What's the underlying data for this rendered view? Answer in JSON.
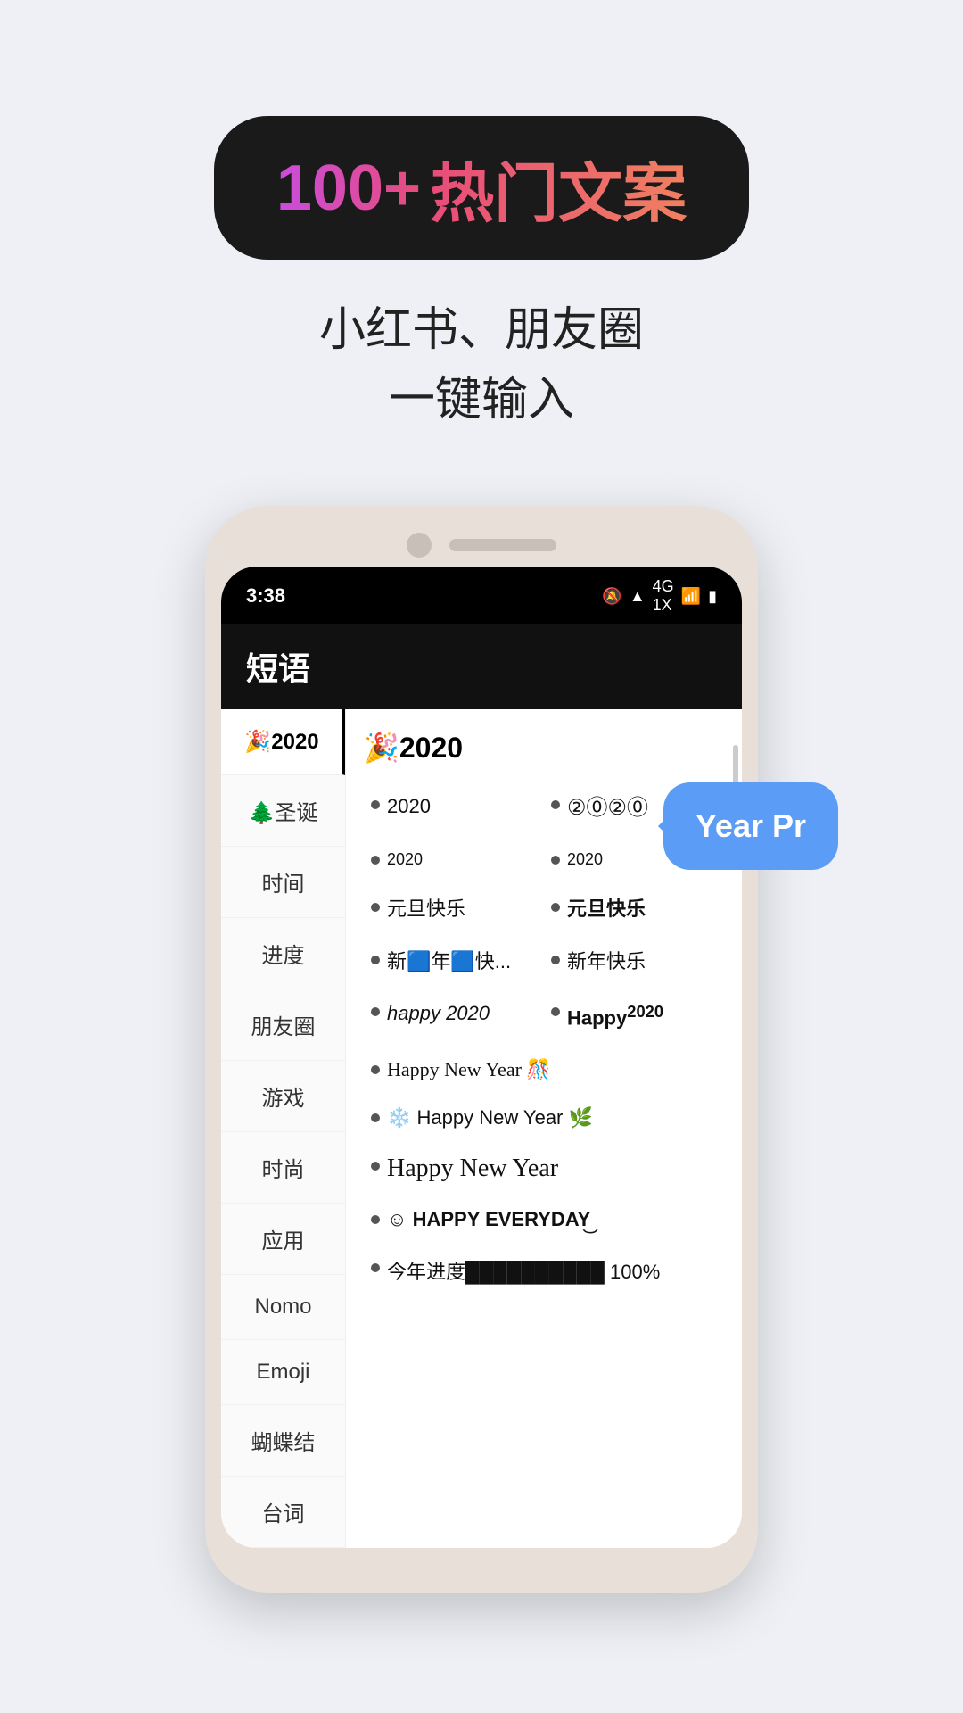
{
  "page": {
    "background": "#eef0f5"
  },
  "badge": {
    "number": "100+",
    "text": "热门文案"
  },
  "subtitle": {
    "line1": "小红书、朋友圈",
    "line2": "一键输入"
  },
  "phone": {
    "status_bar": {
      "time": "3:38",
      "icons": "🔕 📶 4G 1X 📶 🔋"
    },
    "app_title": "短语",
    "sidebar_items": [
      {
        "label": "🎉2020",
        "active": true
      },
      {
        "label": "🌲圣诞"
      },
      {
        "label": "时间"
      },
      {
        "label": "进度"
      },
      {
        "label": "朋友圈"
      },
      {
        "label": "游戏"
      },
      {
        "label": "时尚"
      },
      {
        "label": "应用"
      },
      {
        "label": "Nomo"
      },
      {
        "label": "Emoji"
      },
      {
        "label": "蝴蝶结"
      },
      {
        "label": "台词"
      }
    ],
    "section_title": "🎉2020",
    "items": [
      {
        "text": "2020",
        "style": "normal",
        "col": 1
      },
      {
        "text": "②⓪②⓪",
        "style": "circled",
        "col": 2
      },
      {
        "text": "2020",
        "style": "small",
        "col": 1
      },
      {
        "text": "2020",
        "style": "small",
        "col": 2
      },
      {
        "text": "元旦快乐",
        "style": "normal",
        "col": 1
      },
      {
        "text": "元旦快乐",
        "style": "bold",
        "col": 2
      },
      {
        "text": "新🟦年🟦快...",
        "style": "normal",
        "col": 1
      },
      {
        "text": "新年快乐",
        "style": "normal",
        "col": 2
      },
      {
        "text": "happy 2020",
        "style": "italic",
        "col": 1
      },
      {
        "text": "Happy²⁰²⁰",
        "style": "bold",
        "col": 2
      },
      {
        "text": "Happy New Year 🎊",
        "style": "serif",
        "full": true
      },
      {
        "text": "❄️ Happy New Year 🌿",
        "style": "normal",
        "full": true
      },
      {
        "text": "Happy New Year",
        "style": "cursive",
        "full": true
      },
      {
        "text": "☺ HAPPY EVERYDAY͜",
        "style": "bold",
        "full": true
      },
      {
        "text": "今年进度██████████ 100%",
        "style": "normal",
        "full": true
      }
    ],
    "speech_bubble": "Year Pr"
  }
}
